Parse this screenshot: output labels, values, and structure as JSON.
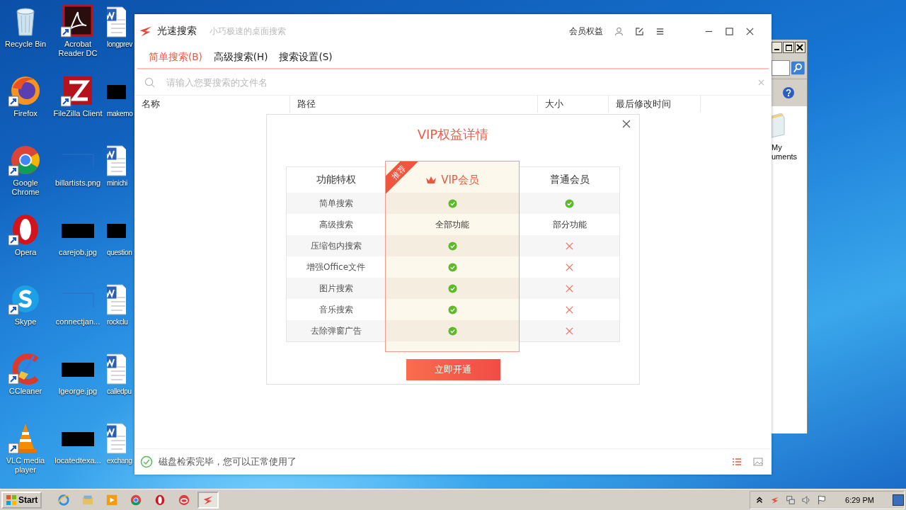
{
  "desktop": {
    "icon_columns": [
      [
        {
          "label": "Recycle Bin",
          "kind": "recycle",
          "shortcut": false
        },
        {
          "label": "Firefox",
          "kind": "firefox",
          "shortcut": true
        },
        {
          "label": "Google Chrome",
          "kind": "chrome",
          "shortcut": true
        },
        {
          "label": "Opera",
          "kind": "opera",
          "shortcut": true
        },
        {
          "label": "Skype",
          "kind": "skype",
          "shortcut": true
        },
        {
          "label": "CCleaner",
          "kind": "ccleaner",
          "shortcut": true
        },
        {
          "label": "VLC media player",
          "kind": "vlc",
          "shortcut": true
        }
      ],
      [
        {
          "label": "Acrobat Reader DC",
          "kind": "acrobat",
          "shortcut": true
        },
        {
          "label": "FileZilla Client",
          "kind": "filezilla",
          "shortcut": true
        },
        {
          "label": "billartists.png",
          "kind": "image-blank",
          "shortcut": false
        },
        {
          "label": "carejob.jpg",
          "kind": "image-black",
          "shortcut": false
        },
        {
          "label": "connectjan...",
          "kind": "image-blank",
          "shortcut": false
        },
        {
          "label": "lgeorge.jpg",
          "kind": "image-black",
          "shortcut": false
        },
        {
          "label": "locatedtexa...",
          "kind": "image-black",
          "shortcut": false
        }
      ],
      [
        {
          "label": "longprev",
          "kind": "word",
          "shortcut": false
        },
        {
          "label": "makemo",
          "kind": "image-black",
          "shortcut": false
        },
        {
          "label": "minichi",
          "kind": "word",
          "shortcut": false
        },
        {
          "label": "question",
          "kind": "image-black",
          "shortcut": false
        },
        {
          "label": "rockclu",
          "kind": "word",
          "shortcut": false
        },
        {
          "label": "calledpu",
          "kind": "word",
          "shortcut": false
        },
        {
          "label": "exchang",
          "kind": "word",
          "shortcut": false
        }
      ]
    ]
  },
  "background_window": {
    "label_lines": [
      "My",
      "uments"
    ]
  },
  "app": {
    "title": "光速搜索",
    "subtitle": "小巧极速的桌面搜索",
    "member_link": "会员权益",
    "tabs": [
      {
        "label": "简单搜索(B)",
        "selected": true
      },
      {
        "label": "高级搜索(H)",
        "selected": false
      },
      {
        "label": "搜索设置(S)",
        "selected": false
      }
    ],
    "search": {
      "placeholder": "请输入您要搜索的文件名"
    },
    "table": {
      "columns": [
        "名称",
        "路径",
        "大小",
        "最后修改时间"
      ]
    },
    "status_bar": {
      "message": "磁盘检索完毕，您可以正常使用了",
      "view_buttons": [
        {
          "kind": "list",
          "selected": true
        },
        {
          "kind": "thumbnail",
          "selected": false
        }
      ]
    }
  },
  "dialog": {
    "title": "VIP权益详情",
    "columns": [
      "功能特权",
      "VIP会员",
      "普通会员"
    ],
    "badge": "推荐",
    "rows": [
      {
        "feature": "简单搜索",
        "vip": {
          "kind": "check"
        },
        "normal": {
          "kind": "check"
        }
      },
      {
        "feature": "高级搜索",
        "vip": {
          "kind": "text",
          "text": "全部功能"
        },
        "normal": {
          "kind": "text",
          "text": "部分功能"
        }
      },
      {
        "feature": "压缩包内搜索",
        "vip": {
          "kind": "check"
        },
        "normal": {
          "kind": "cross"
        }
      },
      {
        "feature": "增强Office文件",
        "vip": {
          "kind": "check"
        },
        "normal": {
          "kind": "cross"
        }
      },
      {
        "feature": "图片搜索",
        "vip": {
          "kind": "check"
        },
        "normal": {
          "kind": "cross"
        }
      },
      {
        "feature": "音乐搜索",
        "vip": {
          "kind": "check"
        },
        "normal": {
          "kind": "cross"
        }
      },
      {
        "feature": "去除弹窗广告",
        "vip": {
          "kind": "check"
        },
        "normal": {
          "kind": "cross"
        }
      }
    ],
    "button": "立即开通"
  },
  "taskbar": {
    "start": "Start",
    "items": [
      {
        "kind": "ie",
        "active": false
      },
      {
        "kind": "explorer",
        "active": false
      },
      {
        "kind": "media",
        "active": false
      },
      {
        "kind": "chrome",
        "active": false
      },
      {
        "kind": "opera",
        "active": false
      },
      {
        "kind": "cloud",
        "active": false
      },
      {
        "kind": "swift",
        "active": true
      }
    ],
    "clock": "6:29 PM"
  }
}
